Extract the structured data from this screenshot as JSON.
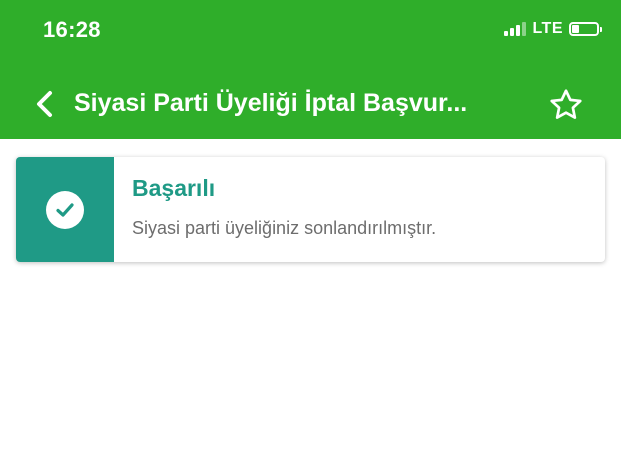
{
  "status_bar": {
    "time": "16:28",
    "network": "LTE",
    "signal_bars": 4,
    "signal_active": 3,
    "battery_level": 0.3
  },
  "nav": {
    "back_icon": "chevron-left-icon",
    "title": "Siyasi Parti Üyeliği İptal Başvur...",
    "favorite_icon": "star-outline-icon"
  },
  "result_card": {
    "icon": "check-circle-icon",
    "title": "Başarılı",
    "message": "Siyasi parti üyeliğiniz sonlandırılmıştır."
  },
  "colors": {
    "header_green": "#2fae2a",
    "success_teal": "#1f9a86",
    "message_gray": "#6d6d6d"
  }
}
